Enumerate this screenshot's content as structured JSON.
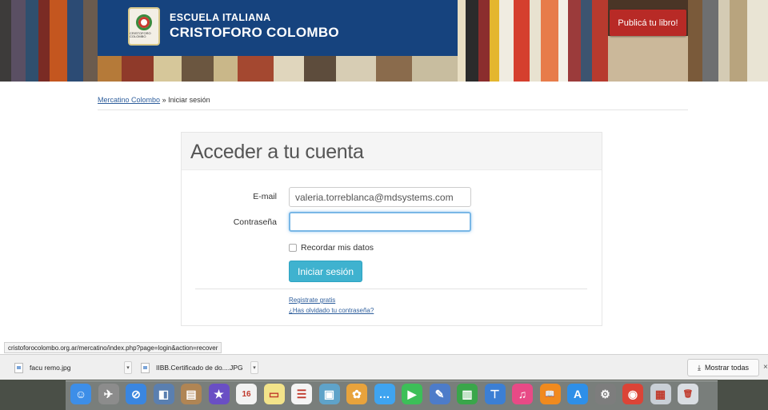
{
  "banner": {
    "school_line1": "ESCUELA ITALIANA",
    "school_line2": "CRISTOFORO COLOMBO",
    "logo_text": "CRISTOFORO COLOMBO",
    "publish_button": "Publicá tu libro!",
    "colors": {
      "header": "#16437e",
      "publish": "#b82a26"
    }
  },
  "breadcrumb": {
    "home": "Mercatino Colombo",
    "separator": "»",
    "current": "Iniciar sesión"
  },
  "login": {
    "title": "Acceder a tu cuenta",
    "email_label": "E-mail",
    "email_value": "valeria.torreblanca@mdsystems.com",
    "password_label": "Contraseña",
    "password_value": "",
    "remember_label": "Recordar mis datos",
    "submit_label": "Iniciar sesión",
    "register_link": "Registrate gratis",
    "forgot_link": "¿Has olvidado tu contraseña?",
    "accent": "#3fb2cf"
  },
  "status_bar": {
    "url": "cristoforocolombo.org.ar/mercatino/index.php?page=login&action=recover"
  },
  "downloads": {
    "items": [
      {
        "name": "facu remo.jpg"
      },
      {
        "name": "IIBB.Certificado de do....JPG"
      }
    ],
    "show_all": "Mostrar todas",
    "download_icon": "⤓",
    "close_icon": "×",
    "caret": "▾"
  },
  "dock": {
    "icons": [
      {
        "name": "finder-icon",
        "color": "#3d8ee8",
        "glyph": "☺"
      },
      {
        "name": "launchpad-icon",
        "color": "#8c8c8c",
        "glyph": "✈"
      },
      {
        "name": "safari-icon",
        "color": "#3a86e0",
        "glyph": "⊘"
      },
      {
        "name": "preview-icon",
        "color": "#5a7fb0",
        "glyph": "◧"
      },
      {
        "name": "contacts-icon",
        "color": "#b08554",
        "glyph": "▤"
      },
      {
        "name": "imovie-icon",
        "color": "#6a4fc4",
        "glyph": "★"
      },
      {
        "name": "calendar-icon",
        "color": "#f2f2f2",
        "glyph": "16"
      },
      {
        "name": "notes-icon",
        "color": "#f2e38a",
        "glyph": "▭"
      },
      {
        "name": "reminders-icon",
        "color": "#f4f4f4",
        "glyph": "☰"
      },
      {
        "name": "photo-viewer-icon",
        "color": "#5fa3c9",
        "glyph": "▣"
      },
      {
        "name": "photos-icon",
        "color": "#e8a33c",
        "glyph": "✿"
      },
      {
        "name": "messages-icon",
        "color": "#3fa4f0",
        "glyph": "…"
      },
      {
        "name": "facetime-icon",
        "color": "#3cbf58",
        "glyph": "▶"
      },
      {
        "name": "textedit-icon",
        "color": "#4d7cc9",
        "glyph": "✎"
      },
      {
        "name": "numbers-icon",
        "color": "#3aa64a",
        "glyph": "▥"
      },
      {
        "name": "keynote-icon",
        "color": "#3c7fd4",
        "glyph": "⊤"
      },
      {
        "name": "itunes-icon",
        "color": "#e84a86",
        "glyph": "♫"
      },
      {
        "name": "ibooks-icon",
        "color": "#f08a1e",
        "glyph": "📖"
      },
      {
        "name": "app-store-icon",
        "color": "#2e8fe8",
        "glyph": "A"
      },
      {
        "name": "system-preferences-icon",
        "color": "#7d7d7d",
        "glyph": "⚙"
      },
      {
        "name": "chrome-icon",
        "color": "#db4437",
        "glyph": "◉"
      },
      {
        "name": "downloads-folder-icon",
        "color": "#c9cfd6",
        "glyph": "▦"
      },
      {
        "name": "trash-icon",
        "color": "#d9dde2",
        "glyph": "🗑"
      }
    ]
  }
}
